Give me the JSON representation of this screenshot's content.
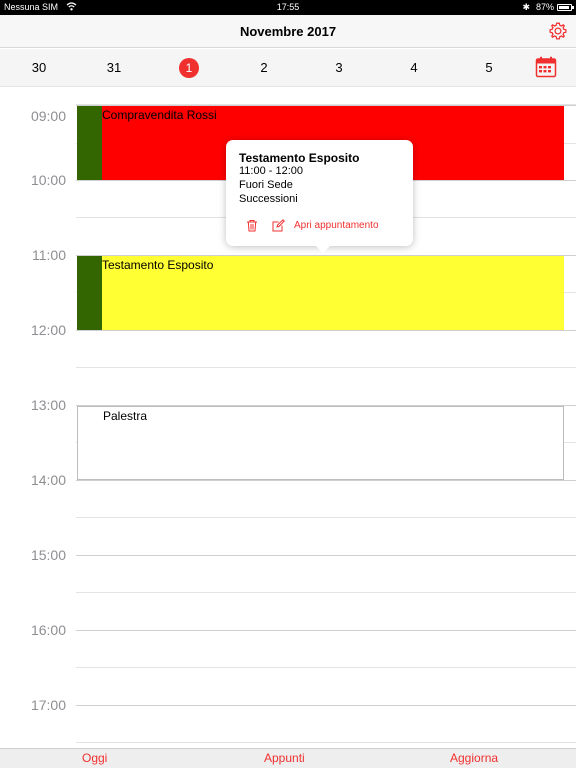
{
  "status_bar": {
    "carrier": "Nessuna SIM",
    "time": "17:55",
    "battery": "87%",
    "battery_level": 0.87
  },
  "nav": {
    "title": "Novembre 2017",
    "settings_icon": "gear-icon"
  },
  "week": {
    "days": [
      "30",
      "31",
      "1",
      "2",
      "3",
      "4",
      "5"
    ],
    "selected_index": 2,
    "calendar_icon": "calendar-icon"
  },
  "hours": [
    "09:00",
    "10:00",
    "11:00",
    "12:00",
    "13:00",
    "14:00",
    "15:00",
    "16:00",
    "17:00"
  ],
  "events": [
    {
      "title": "Compravendita Rossi",
      "start": "09:00",
      "end": "10:00",
      "color": "#ff0000",
      "stripe_color": "#336600"
    },
    {
      "title": "Testamento Esposito",
      "start": "11:00",
      "end": "12:00",
      "color": "#ffff33",
      "stripe_color": "#336600"
    },
    {
      "title": "Palestra",
      "start": "13:00",
      "end": "14:00",
      "color": "#ffffff",
      "stripe_color": ""
    }
  ],
  "popover": {
    "title": "Testamento Esposito",
    "time": "11:00 - 12:00",
    "location": "Fuori Sede",
    "category": "Successioni",
    "open_label": "Apri appuntamento",
    "delete_icon": "trash-icon",
    "edit_icon": "edit-icon"
  },
  "toolbar": {
    "today_label": "Oggi",
    "notes_label": "Appunti",
    "refresh_label": "Aggiorna"
  },
  "accent_color": "#f0302f"
}
